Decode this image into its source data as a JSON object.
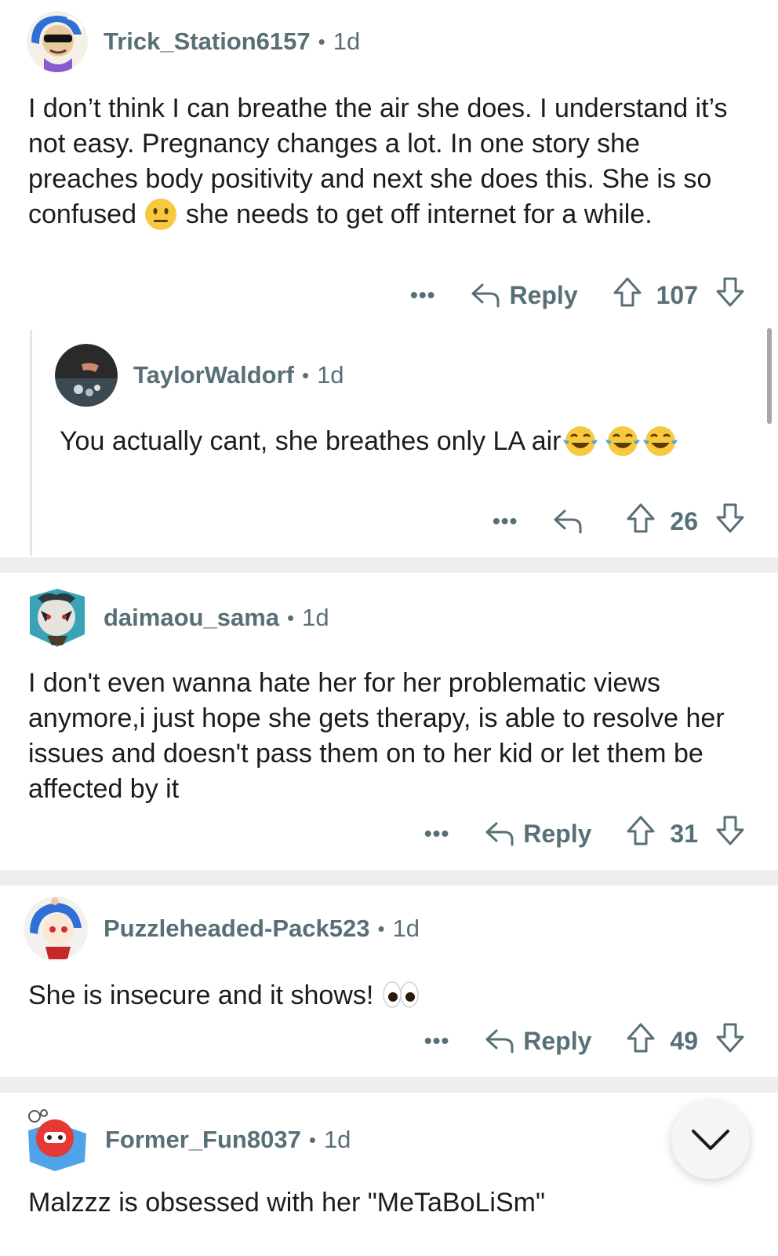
{
  "comments": [
    {
      "username": "Trick_Station6157",
      "age": "1d",
      "text_parts": [
        "I don’t think I can breathe the air she does. I understand it’s not easy. Pregnancy changes a lot. In one story she preaches body positivity and next she does this. She is so confused ",
        " she needs to get off internet for a while."
      ],
      "emoji": "neutral-face",
      "more": "•••",
      "reply_label": "Reply",
      "score": "107"
    },
    {
      "username": "TaylorWaldorf",
      "age": "1d",
      "text": "You actually cant, she breathes only LA air",
      "emoji": "tears-of-joy",
      "more": "•••",
      "score": "26"
    },
    {
      "username": "daimaou_sama",
      "age": "1d",
      "text": "I don't even wanna hate her for her problematic views anymore,i just hope she gets therapy, is able to resolve her issues and doesn't pass them on to her kid or let them be affected by it",
      "more": "•••",
      "reply_label": "Reply",
      "score": "31"
    },
    {
      "username": "Puzzleheaded-Pack523",
      "age": "1d",
      "text": "She is insecure and it shows! ",
      "emoji": "eyes",
      "more": "•••",
      "reply_label": "Reply",
      "score": "49"
    },
    {
      "username": "Former_Fun8037",
      "age": "1d",
      "text": "Malzzz is obsessed with her \"MeTaBoLiSm\""
    }
  ],
  "separator": "•",
  "icons": {
    "reply": "reply-arrow-icon",
    "upvote": "upvote-arrow-icon",
    "downvote": "downvote-arrow-icon",
    "fab": "chevron-down-icon"
  },
  "colors": {
    "meta": "#576f76",
    "text": "#1c1c1c",
    "divider": "#eceef0"
  }
}
